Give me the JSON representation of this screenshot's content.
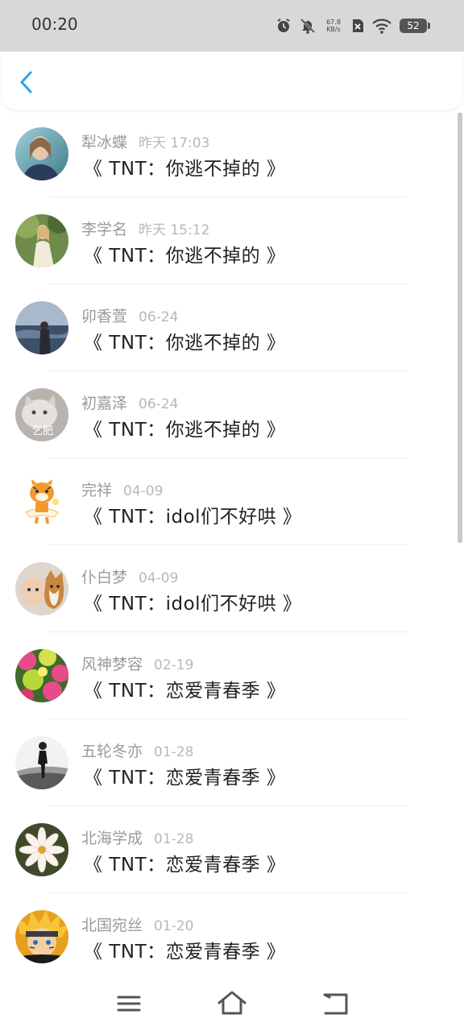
{
  "status_bar": {
    "time": "00:20",
    "net_speed_value": "67.8",
    "net_speed_unit": "KB/s",
    "battery": "52"
  },
  "comments": [
    {
      "name": "犁冰蝶",
      "date": "昨天 17:03",
      "title": "《 TNT：你逃不掉的 》"
    },
    {
      "name": "李学名",
      "date": "昨天 15:12",
      "title": "《 TNT：你逃不掉的 》"
    },
    {
      "name": "卯香萱",
      "date": "06-24",
      "title": "《 TNT：你逃不掉的 》"
    },
    {
      "name": "初嘉泽",
      "date": "06-24",
      "title": "《 TNT：你逃不掉的 》",
      "avatar_text": "乞肥"
    },
    {
      "name": "完祥",
      "date": "04-09",
      "title": "《 TNT：idol们不好哄 》"
    },
    {
      "name": "仆白梦",
      "date": "04-09",
      "title": "《 TNT：idol们不好哄 》"
    },
    {
      "name": "风神梦容",
      "date": "02-19",
      "title": "《 TNT：恋爱青春季 》"
    },
    {
      "name": "五轮冬亦",
      "date": "01-28",
      "title": "《 TNT：恋爱青春季 》"
    },
    {
      "name": "北海学成",
      "date": "01-28",
      "title": "《 TNT：恋爱青春季 》"
    },
    {
      "name": "北国宛丝",
      "date": "01-20",
      "title": "《 TNT：恋爱青春季 》"
    }
  ],
  "colors": {
    "accent": "#2aa3e8",
    "status_bar_bg": "#d8d8d8"
  },
  "icons": {
    "back": "chevron-left-icon",
    "menu": "menu-icon",
    "home": "home-icon",
    "return": "return-icon"
  }
}
